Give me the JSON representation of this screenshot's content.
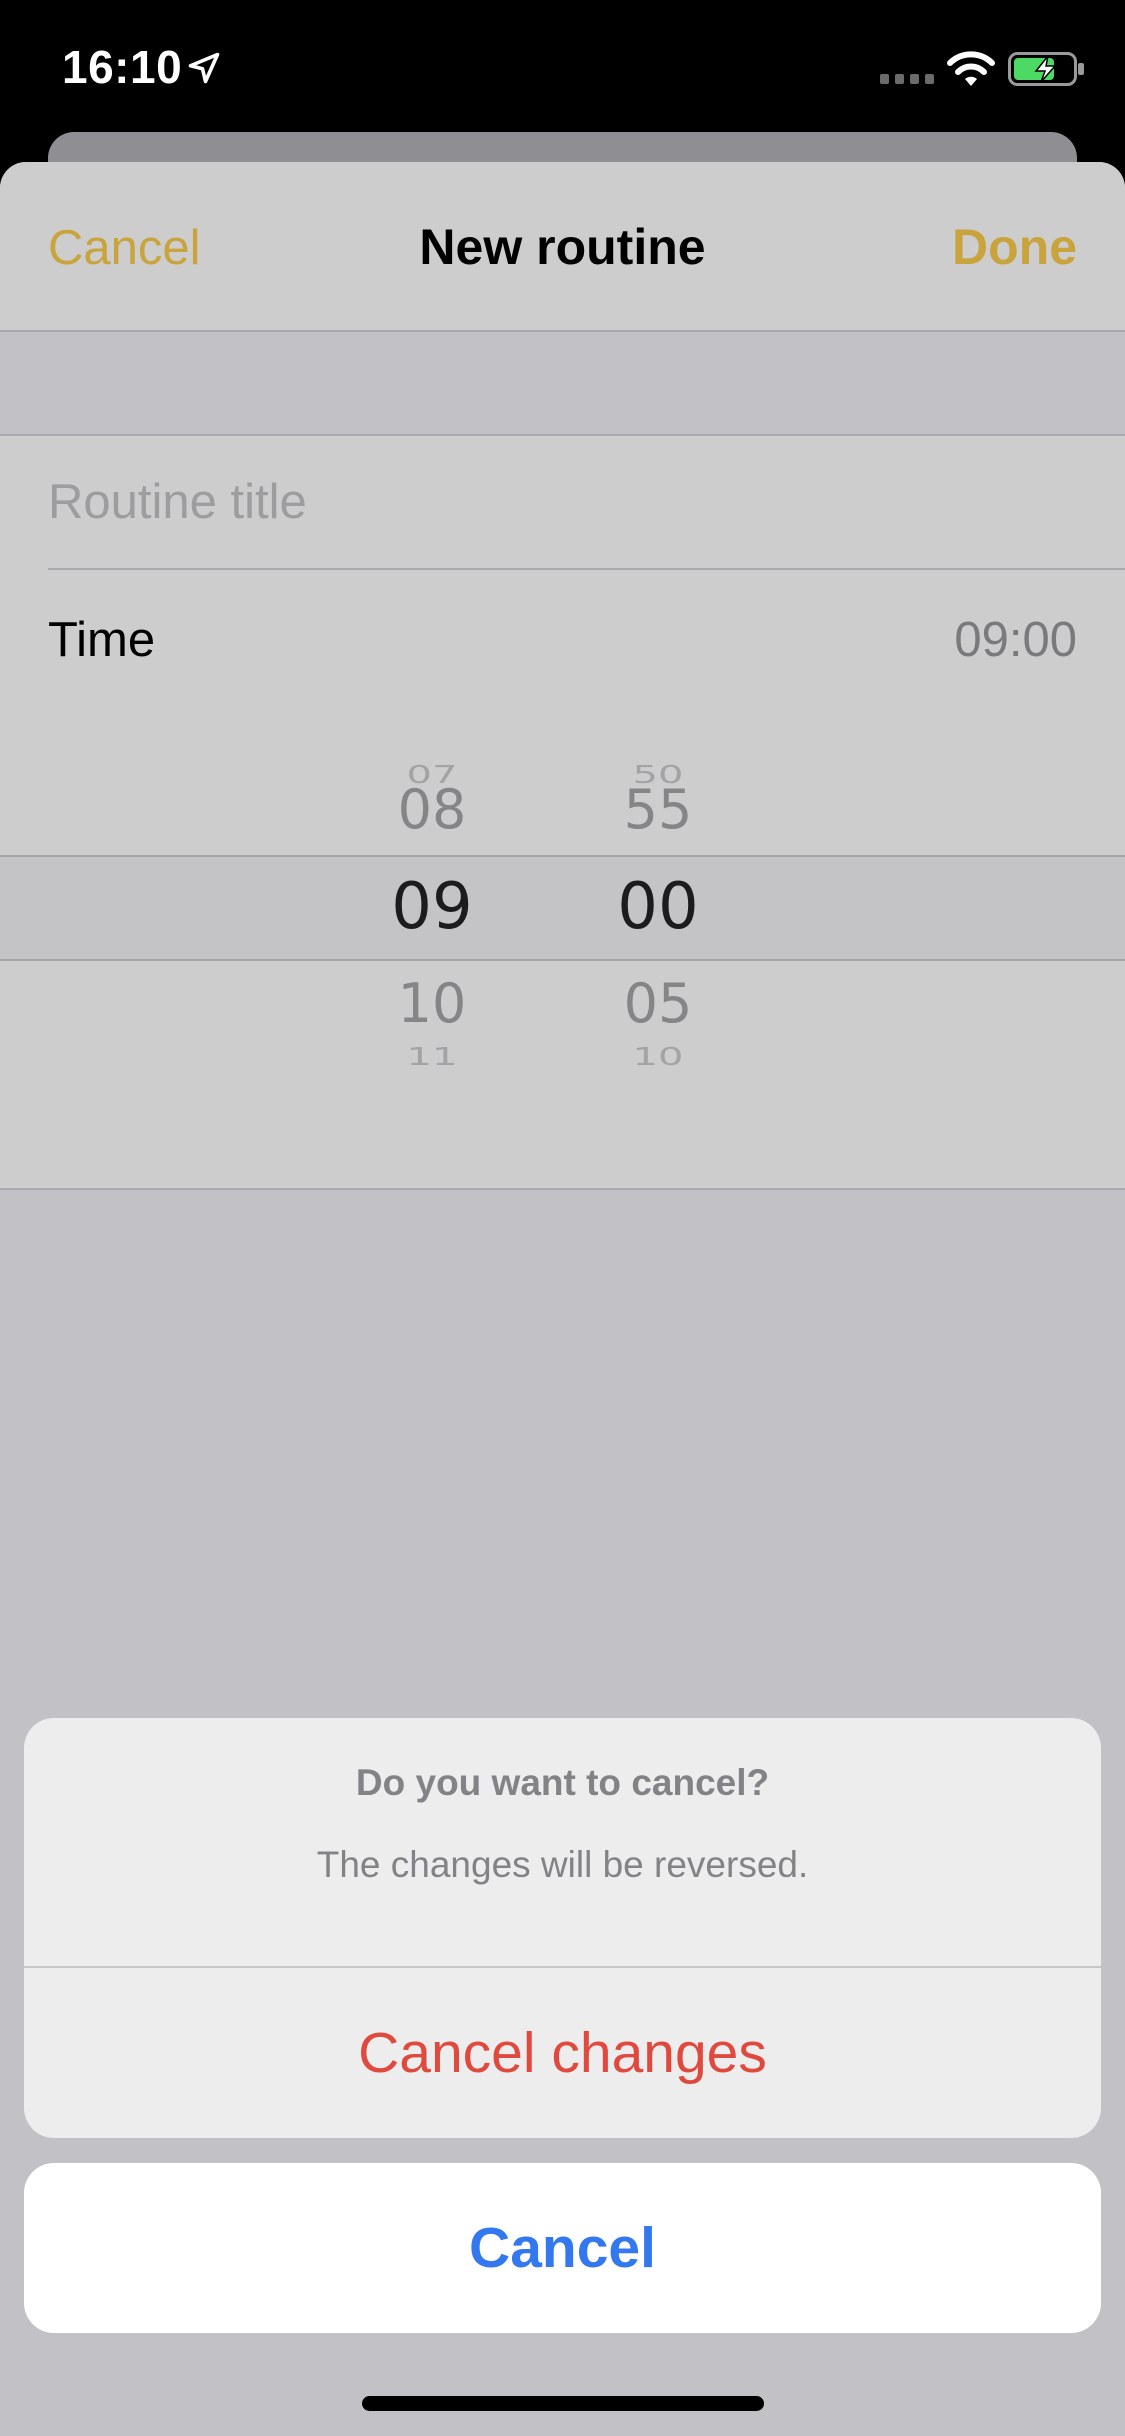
{
  "status_bar": {
    "time": "16:10",
    "icons": [
      "location-arrow-icon",
      "cellular-signal-icon",
      "wifi-icon",
      "battery-charging-icon"
    ]
  },
  "nav": {
    "cancel_label": "Cancel",
    "title": "New routine",
    "done_label": "Done"
  },
  "form": {
    "title_placeholder": "Routine title",
    "title_value": "",
    "time_label": "Time",
    "time_value": "09:00"
  },
  "picker": {
    "hours": [
      "07",
      "08",
      "09",
      "10",
      "11"
    ],
    "minutes": [
      "50",
      "55",
      "00",
      "05",
      "10"
    ],
    "selected_hour": "09",
    "selected_minute": "00"
  },
  "action_sheet": {
    "title": "Do you want to cancel?",
    "message": "The changes will be reversed.",
    "destructive_label": "Cancel changes",
    "cancel_label": "Cancel"
  },
  "colors": {
    "accent": "#c9a43c",
    "destructive": "#e0493e",
    "link": "#3478f0",
    "battery_fill": "#4cd964"
  }
}
